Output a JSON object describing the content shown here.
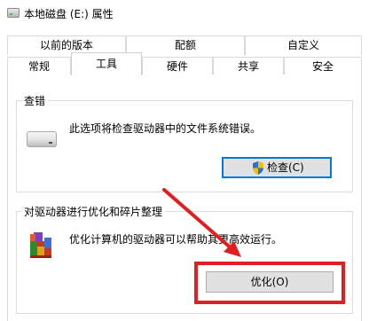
{
  "window": {
    "title": "本地磁盘 (E:) 属性"
  },
  "tabs_row1": [
    {
      "label": "以前的版本"
    },
    {
      "label": "配额"
    },
    {
      "label": "自定义"
    }
  ],
  "tabs_row2": [
    {
      "label": "常规"
    },
    {
      "label": "工具",
      "active": true
    },
    {
      "label": "硬件"
    },
    {
      "label": "共享"
    },
    {
      "label": "安全"
    }
  ],
  "error_check": {
    "group_label": "查错",
    "description": "此选项将检查驱动器中的文件系统错误。",
    "button_label": "检查(C)",
    "icon": "drive-icon"
  },
  "optimize": {
    "group_label": "对驱动器进行优化和碎片整理",
    "description": "优化计算机的驱动器可以帮助其更高效运行。",
    "button_label": "优化(O)",
    "icon": "defrag-icon"
  },
  "annotations": {
    "arrow_color": "#e02020",
    "highlight_color": "#e02020"
  }
}
